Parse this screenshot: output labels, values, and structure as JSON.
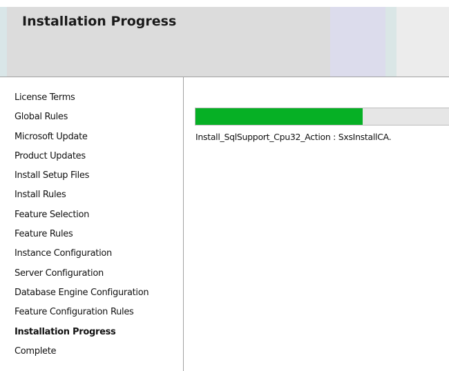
{
  "header": {
    "title": "Installation Progress"
  },
  "sidebar": {
    "items": [
      {
        "label": "License Terms"
      },
      {
        "label": "Global Rules"
      },
      {
        "label": "Microsoft Update"
      },
      {
        "label": "Product Updates"
      },
      {
        "label": "Install Setup Files"
      },
      {
        "label": "Install Rules"
      },
      {
        "label": "Feature Selection"
      },
      {
        "label": "Feature Rules"
      },
      {
        "label": "Instance Configuration"
      },
      {
        "label": "Server Configuration"
      },
      {
        "label": "Database Engine Configuration"
      },
      {
        "label": "Feature Configuration Rules"
      },
      {
        "label": "Installation Progress"
      },
      {
        "label": "Complete"
      }
    ],
    "current_index": 12
  },
  "main": {
    "progress_fraction": 0.66,
    "progress_color": "#06b025",
    "status_text": "Install_SqlSupport_Cpu32_Action : SxsInstallCA."
  }
}
